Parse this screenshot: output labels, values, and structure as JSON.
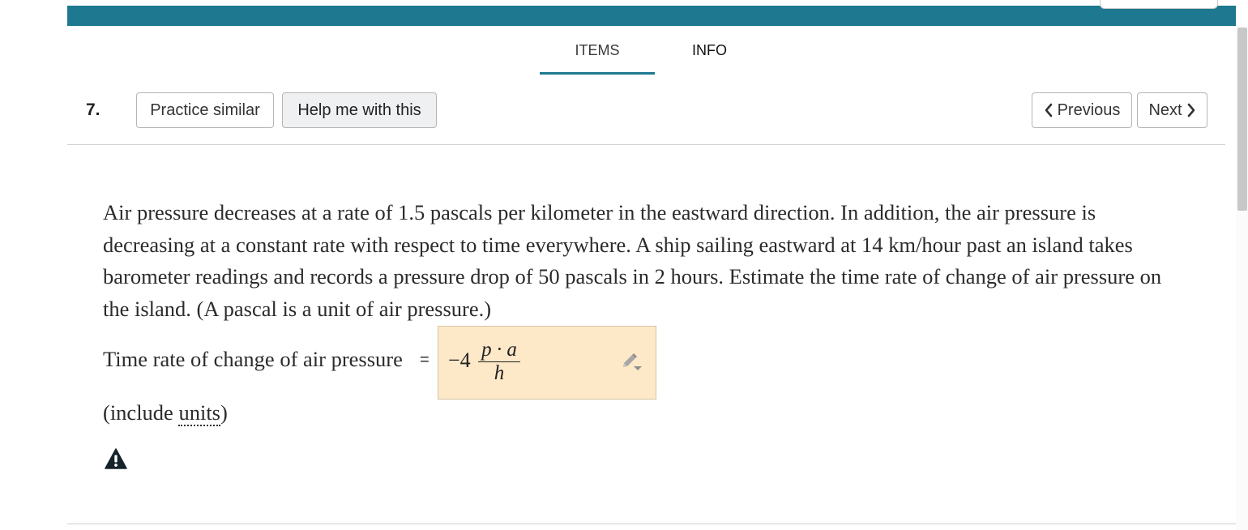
{
  "tabs": {
    "items": "ITEMS",
    "info": "INFO"
  },
  "question_number": "7.",
  "buttons": {
    "practice_similar": "Practice similar",
    "help": "Help me with this",
    "previous": "Previous",
    "next": "Next"
  },
  "question": {
    "text": "Air pressure decreases at a rate of 1.5 pascals per kilometer in the eastward direction. In addition, the air pressure is decreasing at a constant rate with respect to time everywhere. A ship sailing eastward at 14 km/hour past an island takes barometer readings and records a pressure drop of 50 pascals in 2 hours. Estimate the time rate of change of air pressure on the island. (A pascal is a unit of air pressure.)"
  },
  "answer": {
    "label": "Time rate of change of air pressure",
    "equals": "=",
    "coefficient": "−4",
    "numerator": "p · a",
    "denominator": "h"
  },
  "units_note": {
    "before": "(include ",
    "link": "units",
    "after": ")"
  },
  "icons": {
    "answer_edit": "pencil-icon",
    "warning": "warning-icon",
    "previous": "chevron-left-icon",
    "next": "chevron-right-icon"
  },
  "colors": {
    "accent": "#1d7890",
    "answer_box_bg": "#fde8c8",
    "help_button_bg": "#eef0f2"
  }
}
